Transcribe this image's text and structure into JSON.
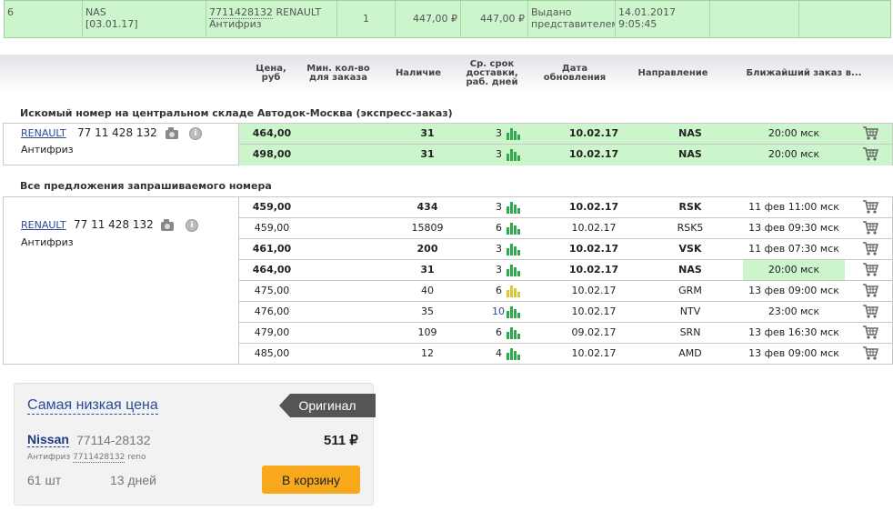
{
  "order": {
    "num": "6",
    "supplier": "NAS",
    "supplier_date": "[03.01.17]",
    "part_code": "7711428132",
    "brand": "RENAULT",
    "part_name": "Антифриз",
    "qty": "1",
    "price": "447,00 ₽",
    "sum": "447,00 ₽",
    "status": "Выдано представителем",
    "date": "14.01.2017",
    "time": "9:05:45"
  },
  "columns": {
    "price": [
      "Цена,",
      "руб"
    ],
    "min_qty": [
      "Мин. кол-во",
      "для заказа"
    ],
    "stock": "Наличие",
    "delivery": [
      "Ср. срок",
      "доставки,",
      "раб. дней"
    ],
    "updated": [
      "Дата",
      "обновления"
    ],
    "direction": "Направление",
    "nearest": "Ближайший заказ в..."
  },
  "section_central": {
    "title": "Искомый номер на центральном складе Автодок-Москва (экспресс-заказ)",
    "brand": "RENAULT",
    "part_number": "77 11 428 132",
    "part_name": "Антифриз",
    "info_icon": "i",
    "rows": [
      {
        "price": "464,00",
        "stock": "31",
        "days": "3",
        "date": "10.02.17",
        "direction": "NAS",
        "nearest": "20:00 мск",
        "bars": "green"
      },
      {
        "price": "498,00",
        "stock": "31",
        "days": "3",
        "date": "10.02.17",
        "direction": "NAS",
        "nearest": "20:00 мск",
        "bars": "green"
      }
    ]
  },
  "section_all": {
    "title": "Все предложения запрашиваемого номера",
    "brand": "RENAULT",
    "part_number": "77 11 428 132",
    "part_name": "Антифриз",
    "info_icon": "i",
    "rows": [
      {
        "price": "459,00",
        "stock": "434",
        "days": "3",
        "date": "10.02.17",
        "direction": "RSK",
        "nearest": "11 фев 11:00 мск",
        "bold": true,
        "bars": "green"
      },
      {
        "price": "459,00",
        "stock": "15809",
        "days": "6",
        "date": "10.02.17",
        "direction": "RSK5",
        "nearest": "13 фев 09:30 мск",
        "bold": false,
        "bars": "green"
      },
      {
        "price": "461,00",
        "stock": "200",
        "days": "3",
        "date": "10.02.17",
        "direction": "VSK",
        "nearest": "11 фев 07:30 мск",
        "bold": true,
        "bars": "green"
      },
      {
        "price": "464,00",
        "stock": "31",
        "days": "3",
        "date": "10.02.17",
        "direction": "NAS",
        "nearest": "20:00 мск",
        "bold": true,
        "bars": "green",
        "highlight": true
      },
      {
        "price": "475,00",
        "stock": "40",
        "days": "6",
        "date": "10.02.17",
        "direction": "GRM",
        "nearest": "13 фев 09:00 мск",
        "bold": false,
        "bars": "yellow"
      },
      {
        "price": "476,00",
        "stock": "35",
        "days": "10",
        "date": "10.02.17",
        "direction": "NTV",
        "nearest": "23:00 мск",
        "bold": false,
        "bars": "green",
        "days_blue": true
      },
      {
        "price": "479,00",
        "stock": "109",
        "days": "6",
        "date": "09.02.17",
        "direction": "SRN",
        "nearest": "13 фев 16:30 мск",
        "bold": false,
        "bars": "green"
      },
      {
        "price": "485,00",
        "stock": "12",
        "days": "4",
        "date": "10.02.17",
        "direction": "AMD",
        "nearest": "13 фев 09:00 мск",
        "bold": false,
        "bars": "green"
      }
    ]
  },
  "lowest_price": {
    "title": "Самая низкая цена",
    "badge": "Оригинал",
    "manufacturer": "Nissan",
    "code": "77114-28132",
    "price": "511 ₽",
    "desc_prefix": "Антифриз",
    "desc_code": "7711428132",
    "desc_suffix": "reno",
    "qty": "61 шт",
    "delivery": "13 дней",
    "button": "В корзину"
  },
  "colors": {
    "row_green": "#ccf5cc",
    "bars_green": "#2fa84f",
    "bars_yellow": "#d9c934",
    "button_orange": "#f7a81b",
    "link_blue": "#2a4a9a",
    "badge_dark": "#555555"
  },
  "icons": {
    "camera": "camera-icon",
    "info": "info-icon",
    "availability": "availability-bars-icon",
    "cart": "cart-icon"
  }
}
